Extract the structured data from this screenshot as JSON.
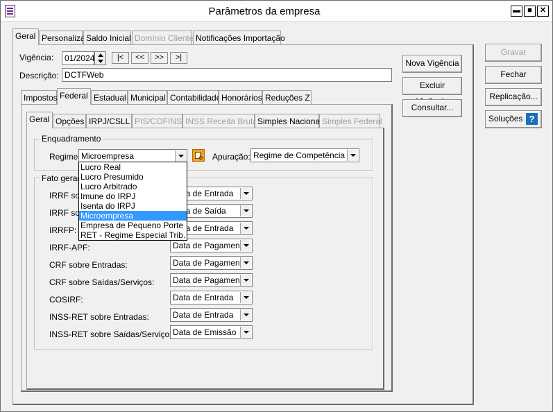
{
  "window": {
    "title": "Parâmetros da empresa"
  },
  "top_tabs": [
    {
      "label": "Geral",
      "active": true,
      "enabled": true
    },
    {
      "label": "Personaliza",
      "active": false,
      "enabled": true
    },
    {
      "label": "Saldo Inicial",
      "active": false,
      "enabled": true
    },
    {
      "label": "Domínio Cliente",
      "active": false,
      "enabled": false
    },
    {
      "label": "Notificações Importação",
      "active": false,
      "enabled": true
    }
  ],
  "form": {
    "vigencia_label": "Vigência:",
    "vigencia_value": "01/2024",
    "nav": [
      "|<",
      "<<",
      ">>",
      ">|"
    ],
    "descricao_label": "Descrição:",
    "descricao_value": "DCTFWeb"
  },
  "mid_tabs": [
    "Impostos",
    "Federal",
    "Estadual",
    "Municipal",
    "Contabilidade",
    "Honorários",
    "Reduções Z"
  ],
  "inner_tabs": [
    {
      "label": "Geral",
      "enabled": true
    },
    {
      "label": "Opções",
      "enabled": true
    },
    {
      "label": "IRPJ/CSLL",
      "enabled": true
    },
    {
      "label": "PIS/COFINS",
      "enabled": false
    },
    {
      "label": "INSS Receita Bruta",
      "enabled": false
    },
    {
      "label": "Simples Nacional",
      "enabled": true
    },
    {
      "label": "Simples Federal",
      "enabled": false
    }
  ],
  "enquadramento": {
    "title": "Enquadramento",
    "regime_label": "Regime:",
    "regime_value": "Microempresa",
    "apuracao_label": "Apuração:",
    "apuracao_value": "Regime de Competência"
  },
  "regime_options": [
    "Lucro Real",
    "Lucro Presumido",
    "Lucro Arbitrado",
    "Imune do IRPJ",
    "Isenta do IRPJ",
    "Microempresa",
    "Empresa de Pequeno Porte",
    "RET - Regime Especial Trib."
  ],
  "regime_selected": "Microempresa",
  "fato_gerador": {
    "title": "Fato gerador",
    "rows": [
      {
        "label": "IRRF sob",
        "value": "Data de Entrada"
      },
      {
        "label": "IRRF sob",
        "value": "Data de Saída"
      },
      {
        "label": "IRRFP:",
        "value": "Data de Entrada"
      },
      {
        "label": "IRRF-APF:",
        "value": "Data de Pagamento"
      },
      {
        "label": "CRF sobre Entradas:",
        "value": "Data de Pagamento"
      },
      {
        "label": "CRF sobre Saídas/Serviços:",
        "value": "Data de Pagamento"
      },
      {
        "label": "COSIRF:",
        "value": "Data de Entrada"
      },
      {
        "label": "INSS-RET sobre Entradas:",
        "value": "Data de Entrada"
      },
      {
        "label": "INSS-RET sobre Saídas/Serviços:",
        "value": "Data de Emissão"
      }
    ]
  },
  "side_buttons": {
    "nova_vigencia": "Nova Vigência",
    "excluir_vigencia": "Excluir Vigência",
    "consultar": "Consultar..."
  },
  "right_buttons": {
    "gravar": "Gravar",
    "fechar": "Fechar",
    "replicacao": "Replicação...",
    "solucoes": "Soluções"
  },
  "colors": {
    "accent": "#3399ff",
    "help_icon": "#1c6fbf"
  }
}
